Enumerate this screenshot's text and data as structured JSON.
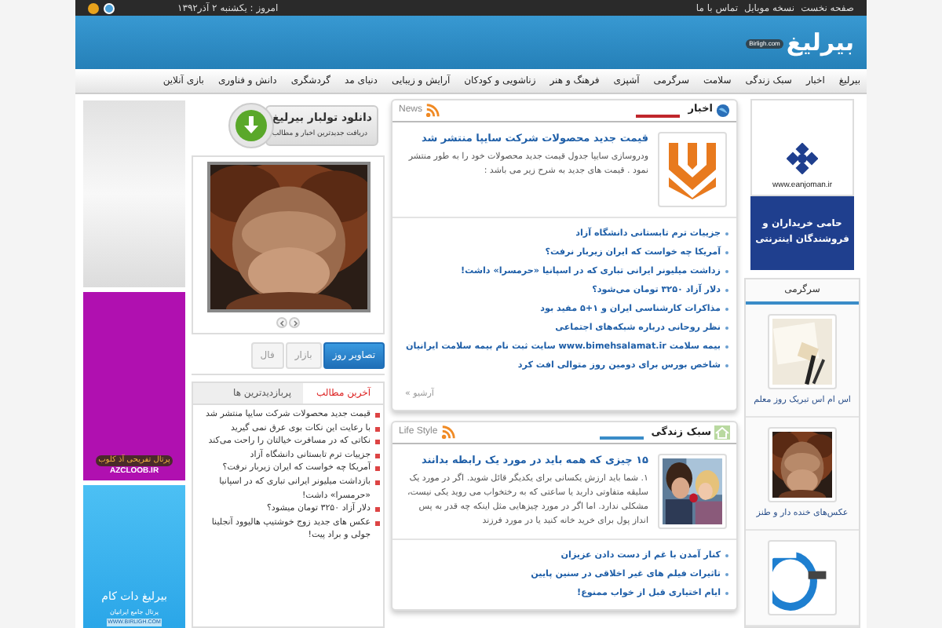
{
  "top_bar": {
    "links": [
      "صفحه نخست",
      "نسخه موبایل",
      "تماس با ما"
    ],
    "date": "امروز : یکشنبه ۲ آذر۱۳۹۲"
  },
  "header": {
    "logo": "بیرلیغ",
    "domain": "Birligh.com"
  },
  "nav": [
    "بیرلیغ",
    "اخبار",
    "سبک زندگی",
    "سلامت",
    "سرگرمی",
    "آشپزی",
    "فرهنگ و هنر",
    "زناشویی و کودکان",
    "آرایش و زیبایی",
    "دنیای مد",
    "گردشگری",
    "دانش و فناوری",
    "بازی آنلاین"
  ],
  "sponsor_ad": {
    "url": "www.eanjoman.ir",
    "slogan": "حامی خریداران و فروشندگان اینترنتی"
  },
  "entertainment": {
    "title": "سرگرمی",
    "items": [
      {
        "kind": "notes",
        "caption": "اس ام اس تبریک روز معلم"
      },
      {
        "kind": "ape",
        "caption": "عکس‌های خنده دار و طنز"
      },
      {
        "kind": "smile"
      }
    ]
  },
  "news": {
    "title": "اخبار",
    "label": "News",
    "featured": {
      "title": "قیمت جدید محصولات شرکت سایپا منتشر شد",
      "summary": "ودروسازی سایپا جدول قیمت جدید محصولات خود را به طور منتشر نمود . قیمت های جدید به شرح زیر می باشد :"
    },
    "links": [
      "جزییات ترم تابستانی دانشگاه آزاد",
      "آمریکا چه خواست که ایران زیربار نرفت؟",
      "زداشت میلیونر ایرانی تباری که در اسپانیا «حرمسرا» داشت!",
      "دلار آزاد ۳۲۵۰ تومان می‌شود؟",
      "مذاکرات کارشناسی ایران و ۱+۵ مفید بود",
      "نظر روحانی درباره شبکه‌های اجتماعی",
      "بیمه سلامت www.bimehsalamat.ir سایت ثبت نام بیمه سلامت ایرانیان",
      "شاخص بورس برای دومین روز متوالی افت کرد"
    ],
    "archive": "آرشیو »"
  },
  "life_style": {
    "title": "سبک زندگی",
    "label": "Life Style",
    "featured": {
      "title": "۱۵ چیزی که همه باید در مورد یک رابطه بدانند",
      "summary": "۱. شما باید ارزش یکسانی برای یکدیگر قائل شوید. اگر در مورد یک سلیقه متفاوتی دارید یا ساعتی که به رختخواب می روید یکی نیست، مشکلی ندارد. اما اگر در مورد چیزهایی مثل اینکه چه قدر به پس انداز پول برای خرید خانه کنید یا در مورد فرزند"
    },
    "links": [
      "کنار آمدن با غم از دست دادن عزیزان",
      "تاثیرات فیلم های غیر اخلاقی در سنین پایین",
      "ایام اختیاری قبل از خواب ممنوع!"
    ]
  },
  "toolbar_download": {
    "title": "دانلود تولبار بیرلیغ",
    "subtitle": "دریافت جدیدترین اخبار و مطالب"
  },
  "photo_tabs": [
    {
      "label": "تصاویر روز",
      "selected": true
    },
    {
      "label": "بازار",
      "selected": false
    },
    {
      "label": "فال",
      "selected": false
    }
  ],
  "posts_tabs": [
    {
      "label": "آخرین مطالب",
      "selected": true
    },
    {
      "label": "پربازدیدترین ها",
      "selected": false
    }
  ],
  "posts": [
    "قیمت جدید محصولات شرکت سایپا منتشر شد",
    "با رعایت این نکات بوی عرق نمی گیرید",
    "نکاتی که در مسافرت خیالتان را راحت می‌کند",
    "جزییات ترم تابستانی دانشگاه آزاد",
    "آمریکا چه خواست که ایران زیربار نرفت؟",
    "بازداشت میلیونر ایرانی تباری که در اسپانیا «حرمسرا» داشت!",
    "دلار آزاد ۳۲۵۰ تومان میشود؟",
    "عکس های جدید زوج خوشتیپ هالیوود آنجلینا جولی و براد پیت!"
  ],
  "ads": [
    {
      "kind": "plain"
    },
    {
      "kind": "azcloob",
      "title": "پرتال تفریحی آذ کلوب",
      "url": "AZCLOOB.IR"
    },
    {
      "kind": "birligh",
      "title": "بیرلیغ دات کام",
      "subtitle": "پرتال جامع ایرانیان",
      "url": "WWW.BIRLIGH.COM"
    }
  ]
}
